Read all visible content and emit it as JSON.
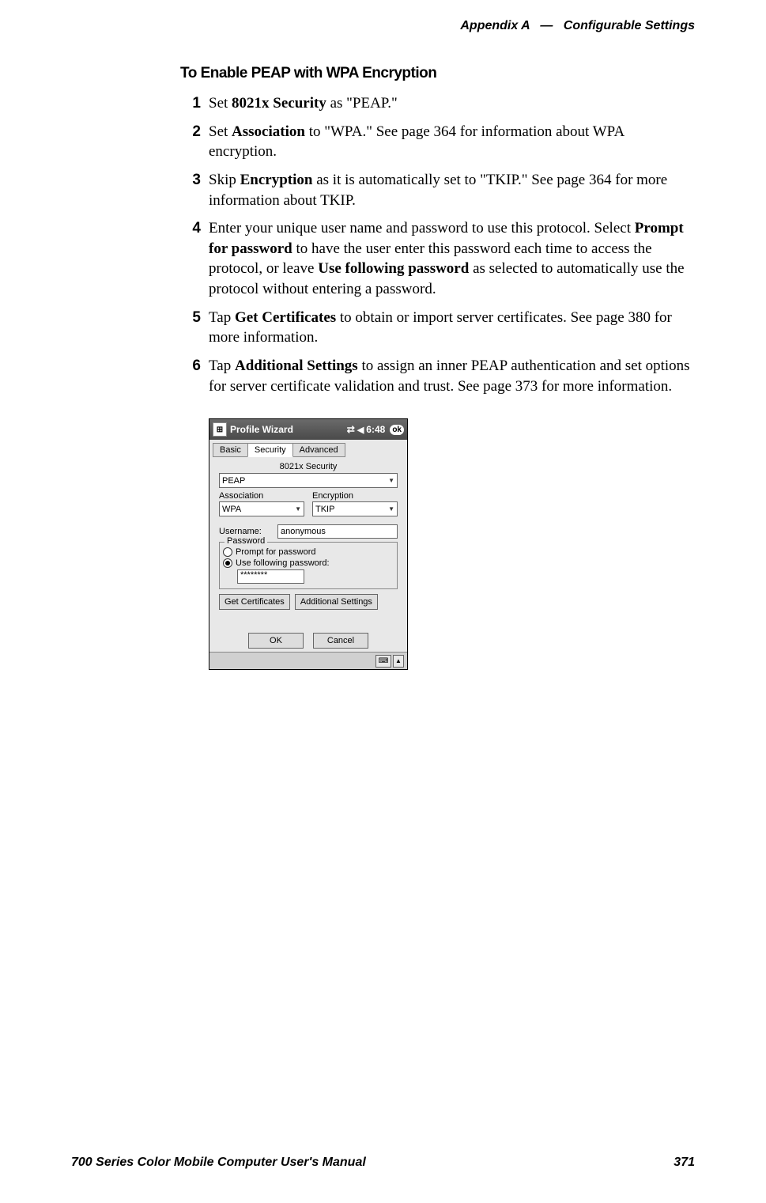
{
  "header": {
    "appendix": "Appendix A",
    "dash": "—",
    "section": "Configurable Settings"
  },
  "content": {
    "title": "To Enable PEAP with WPA Encryption",
    "steps": [
      {
        "num": "1",
        "html": "Set <b>8021x Security</b> as \"PEAP.\""
      },
      {
        "num": "2",
        "html": "Set <b>Association</b> to \"WPA.\" See page 364 for information about WPA encryption."
      },
      {
        "num": "3",
        "html": "Skip <b>Encryption</b> as it is automatically set to \"TKIP.\" See page 364 for more information about TKIP."
      },
      {
        "num": "4",
        "html": "Enter your unique user name and password to use this protocol. Select <b>Prompt for password</b> to have the user enter this password each time to access the protocol, or leave <b>Use following password</b> as selected to automatically use the protocol without entering a password."
      },
      {
        "num": "5",
        "html": "Tap <b>Get Certificates</b> to obtain or import server certificates. See page 380 for more information."
      },
      {
        "num": "6",
        "html": "Tap <b>Additional Settings</b> to assign an inner PEAP authentication and set options for server certificate validation and trust. See page 373 for more information."
      }
    ]
  },
  "screenshot": {
    "titlebar": {
      "title": "Profile Wizard",
      "time": "6:48",
      "ok": "ok"
    },
    "tabs": [
      "Basic",
      "Security",
      "Advanced"
    ],
    "active_tab": "Security",
    "security_label": "8021x Security",
    "security_value": "PEAP",
    "association_label": "Association",
    "association_value": "WPA",
    "encryption_label": "Encryption",
    "encryption_value": "TKIP",
    "username_label": "Username:",
    "username_value": "anonymous",
    "password_legend": "Password",
    "radio_prompt": "Prompt for password",
    "radio_usefollowing": "Use following password:",
    "password_value": "********",
    "btn_getcert": "Get Certificates",
    "btn_addsettings": "Additional Settings",
    "btn_ok": "OK",
    "btn_cancel": "Cancel"
  },
  "footer": {
    "left": "700 Series Color Mobile Computer User's Manual",
    "right": "371"
  }
}
